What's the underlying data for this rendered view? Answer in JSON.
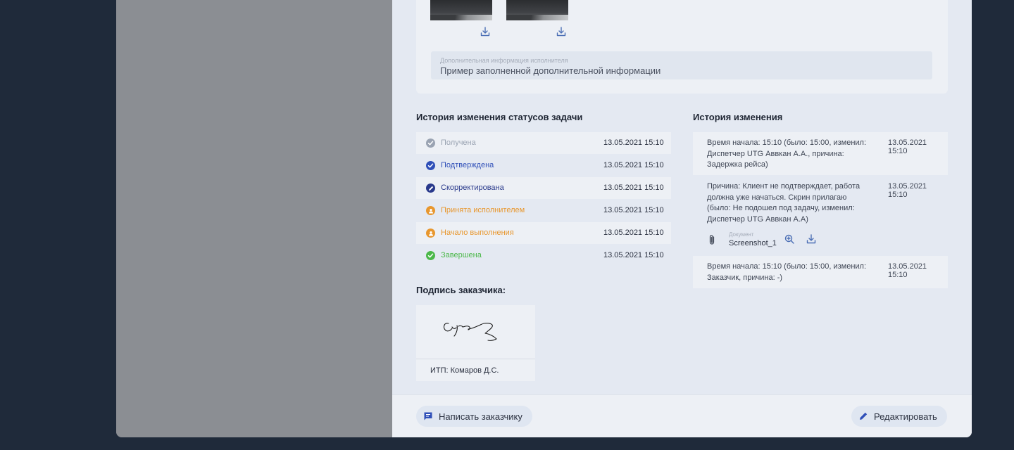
{
  "extra_info": {
    "label": "Дополнительная информация исполнителя",
    "value": "Пример заполненной дополнительной информации"
  },
  "status_history": {
    "title": "История изменения статусов задачи",
    "rows": [
      {
        "label": "Получена",
        "date": "13.05.2021 15:10",
        "color": "#9aa3b2",
        "icon": "check-circle-icon"
      },
      {
        "label": "Подтверждена",
        "date": "13.05.2021 15:10",
        "color": "#2f4fb8",
        "icon": "check-circle-icon"
      },
      {
        "label": "Скорректирована",
        "date": "13.05.2021 15:10",
        "color": "#2a3a8c",
        "icon": "pencil-circle-icon"
      },
      {
        "label": "Принята исполнителем",
        "date": "13.05.2021 15:10",
        "color": "#e8972e",
        "icon": "person-circle-icon"
      },
      {
        "label": "Начало выполнения",
        "date": "13.05.2021 15:10",
        "color": "#e8972e",
        "icon": "person-circle-icon"
      },
      {
        "label": "Завершена",
        "date": "13.05.2021 15:10",
        "color": "#4cb84a",
        "icon": "check-circle-icon"
      }
    ]
  },
  "change_history": {
    "title": "История изменения",
    "items": [
      {
        "text": "Время начала: 15:10 (было: 15:00, изменил: Диспетчер UTG Аввкан А.А., причина: Задержка рейса)",
        "date": "13.05.2021 15:10"
      },
      {
        "text": "Причина: Клиент не подтверждает, работа должна уже начаться. Скрин прилагаю (было: Не подошел под задачу, изменил: Диспетчер UTG Аввкан А.А)",
        "date": "13.05.2021 15:10",
        "doc_label": "Документ",
        "doc_name": "Screenshot_1"
      },
      {
        "text": "Время начала: 15:10 (было: 15:00, изменил: Заказчик, причина: -)",
        "date": "13.05.2021 15:10"
      }
    ]
  },
  "signature": {
    "title": "Подпись заказчика:",
    "name": "ИТП: Комаров Д.С."
  },
  "footer": {
    "message_button": "Написать заказчику",
    "edit_button": "Редактировать"
  }
}
